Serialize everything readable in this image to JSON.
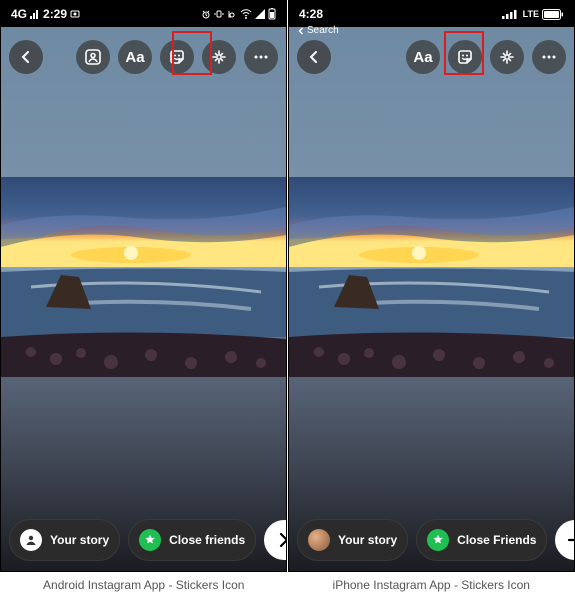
{
  "android": {
    "status": {
      "time": "2:29",
      "net_prefix": "4G"
    },
    "breadcrumb": null,
    "toolbar": {
      "show_tag_people": true,
      "highlight_index": 2
    },
    "bottom": {
      "your_story_label": "Your story",
      "close_friends_label": "Close friends",
      "story_avatar": false
    },
    "caption": "Android Instagram App - Stickers Icon"
  },
  "iphone": {
    "status": {
      "time": "4:28",
      "net_label": "LTE"
    },
    "breadcrumb": "Search",
    "toolbar": {
      "show_tag_people": false,
      "highlight_index": 1
    },
    "bottom": {
      "your_story_label": "Your story",
      "close_friends_label": "Close Friends",
      "story_avatar": true
    },
    "caption": "iPhone Instagram App - Stickers Icon"
  },
  "icons": {
    "text_tool": "Aa"
  }
}
